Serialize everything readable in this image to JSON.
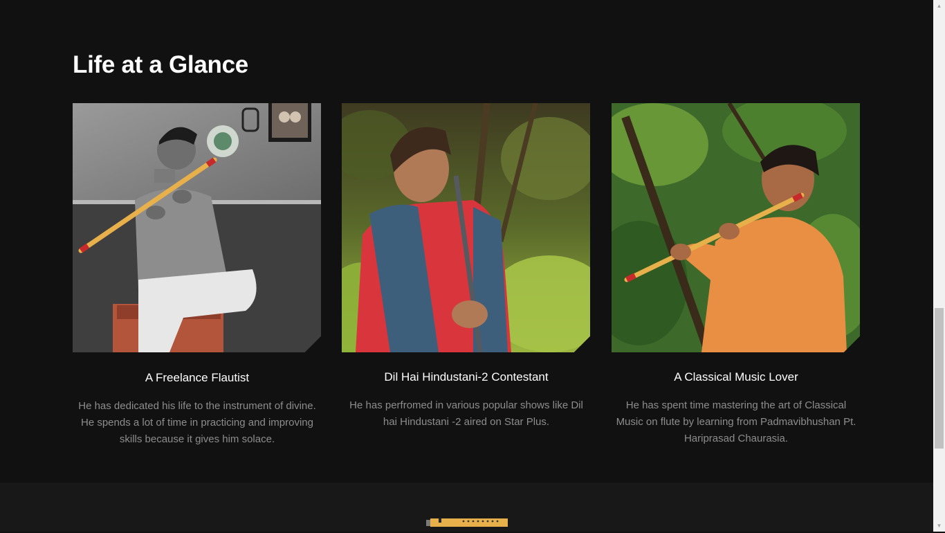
{
  "section": {
    "title": "Life at a Glance"
  },
  "cards": [
    {
      "heading": "A Freelance Flautist",
      "description": "He has dedicated his life to the instrument of divine. He spends a lot of time in practicing and improving skills because it gives him solace.",
      "image_icon": "flute-player-photo"
    },
    {
      "heading": "Dil Hai Hindustani-2 Contestant",
      "description": "He has perfromed in various popular shows like Dil hai Hindustani -2 aired on Star Plus.",
      "image_icon": "flute-player-photo"
    },
    {
      "heading": "A Classical Music Lover",
      "description": "He has spent time mastering the art of Classical Music on flute by learning from Padmavibhushan Pt. Hariprasad Chaurasia.",
      "image_icon": "flute-player-photo"
    }
  ],
  "colors": {
    "background": "#121112",
    "footer": "#181818",
    "heading": "#ffffff",
    "body_text": "#8d8d8d",
    "flute": "#e8b04a"
  },
  "scrollbar": {
    "position_fraction": 0.58
  }
}
